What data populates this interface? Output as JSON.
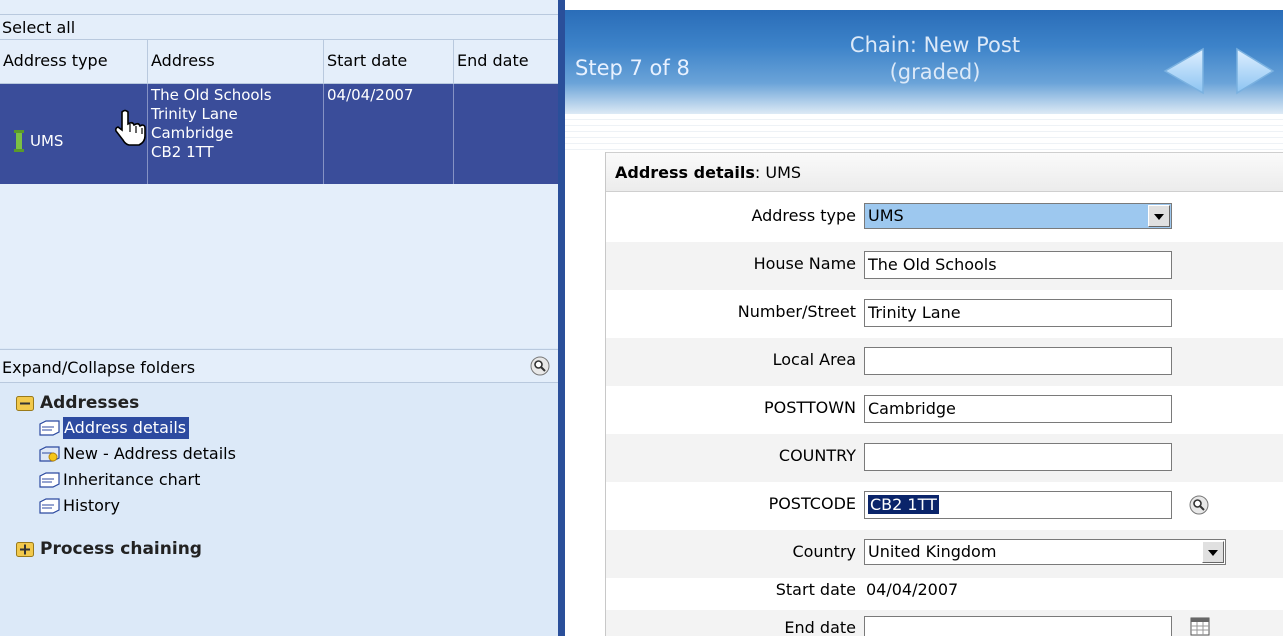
{
  "left": {
    "select_all": "Select all",
    "columns": [
      "Address type",
      "Address",
      "Start date",
      "End date"
    ],
    "selected_row": {
      "type": "UMS",
      "address_lines": [
        "The Old Schools",
        "Trinity Lane",
        "Cambridge",
        "CB2 1TT"
      ],
      "start_date": "04/04/2007",
      "end_date": ""
    },
    "expand_collapse": "Expand/Collapse folders",
    "tree": {
      "folder_addresses": "Addresses",
      "items": [
        "Address details",
        "New - Address details",
        "Inheritance chart",
        "History"
      ],
      "folder_process": "Process chaining"
    }
  },
  "right": {
    "step": "Step 7 of 8",
    "chain_line1": "Chain: New Post",
    "chain_line2": "(graded)",
    "form": {
      "title_bold": "Address details",
      "title_rest": ": UMS",
      "fields": {
        "address_type": {
          "label": "Address type",
          "value": "UMS"
        },
        "house_name": {
          "label": "House Name",
          "value": "The Old Schools"
        },
        "number_street": {
          "label": "Number/Street",
          "value": "Trinity Lane"
        },
        "local_area": {
          "label": "Local Area",
          "value": ""
        },
        "posttown": {
          "label": "POSTTOWN",
          "value": "Cambridge"
        },
        "country_upper": {
          "label": "COUNTRY",
          "value": ""
        },
        "postcode": {
          "label": "POSTCODE",
          "value": "CB2 1TT"
        },
        "country": {
          "label": "Country",
          "value": "United Kingdom"
        },
        "start_date": {
          "label": "Start date",
          "value": "04/04/2007"
        },
        "end_date": {
          "label": "End date",
          "value": ""
        }
      }
    }
  },
  "colors": {
    "accent": "#2a4f9a",
    "selection": "#3a4d9a",
    "header_blue": "#3d83c9",
    "select_highlight": "#9dc8ef"
  }
}
